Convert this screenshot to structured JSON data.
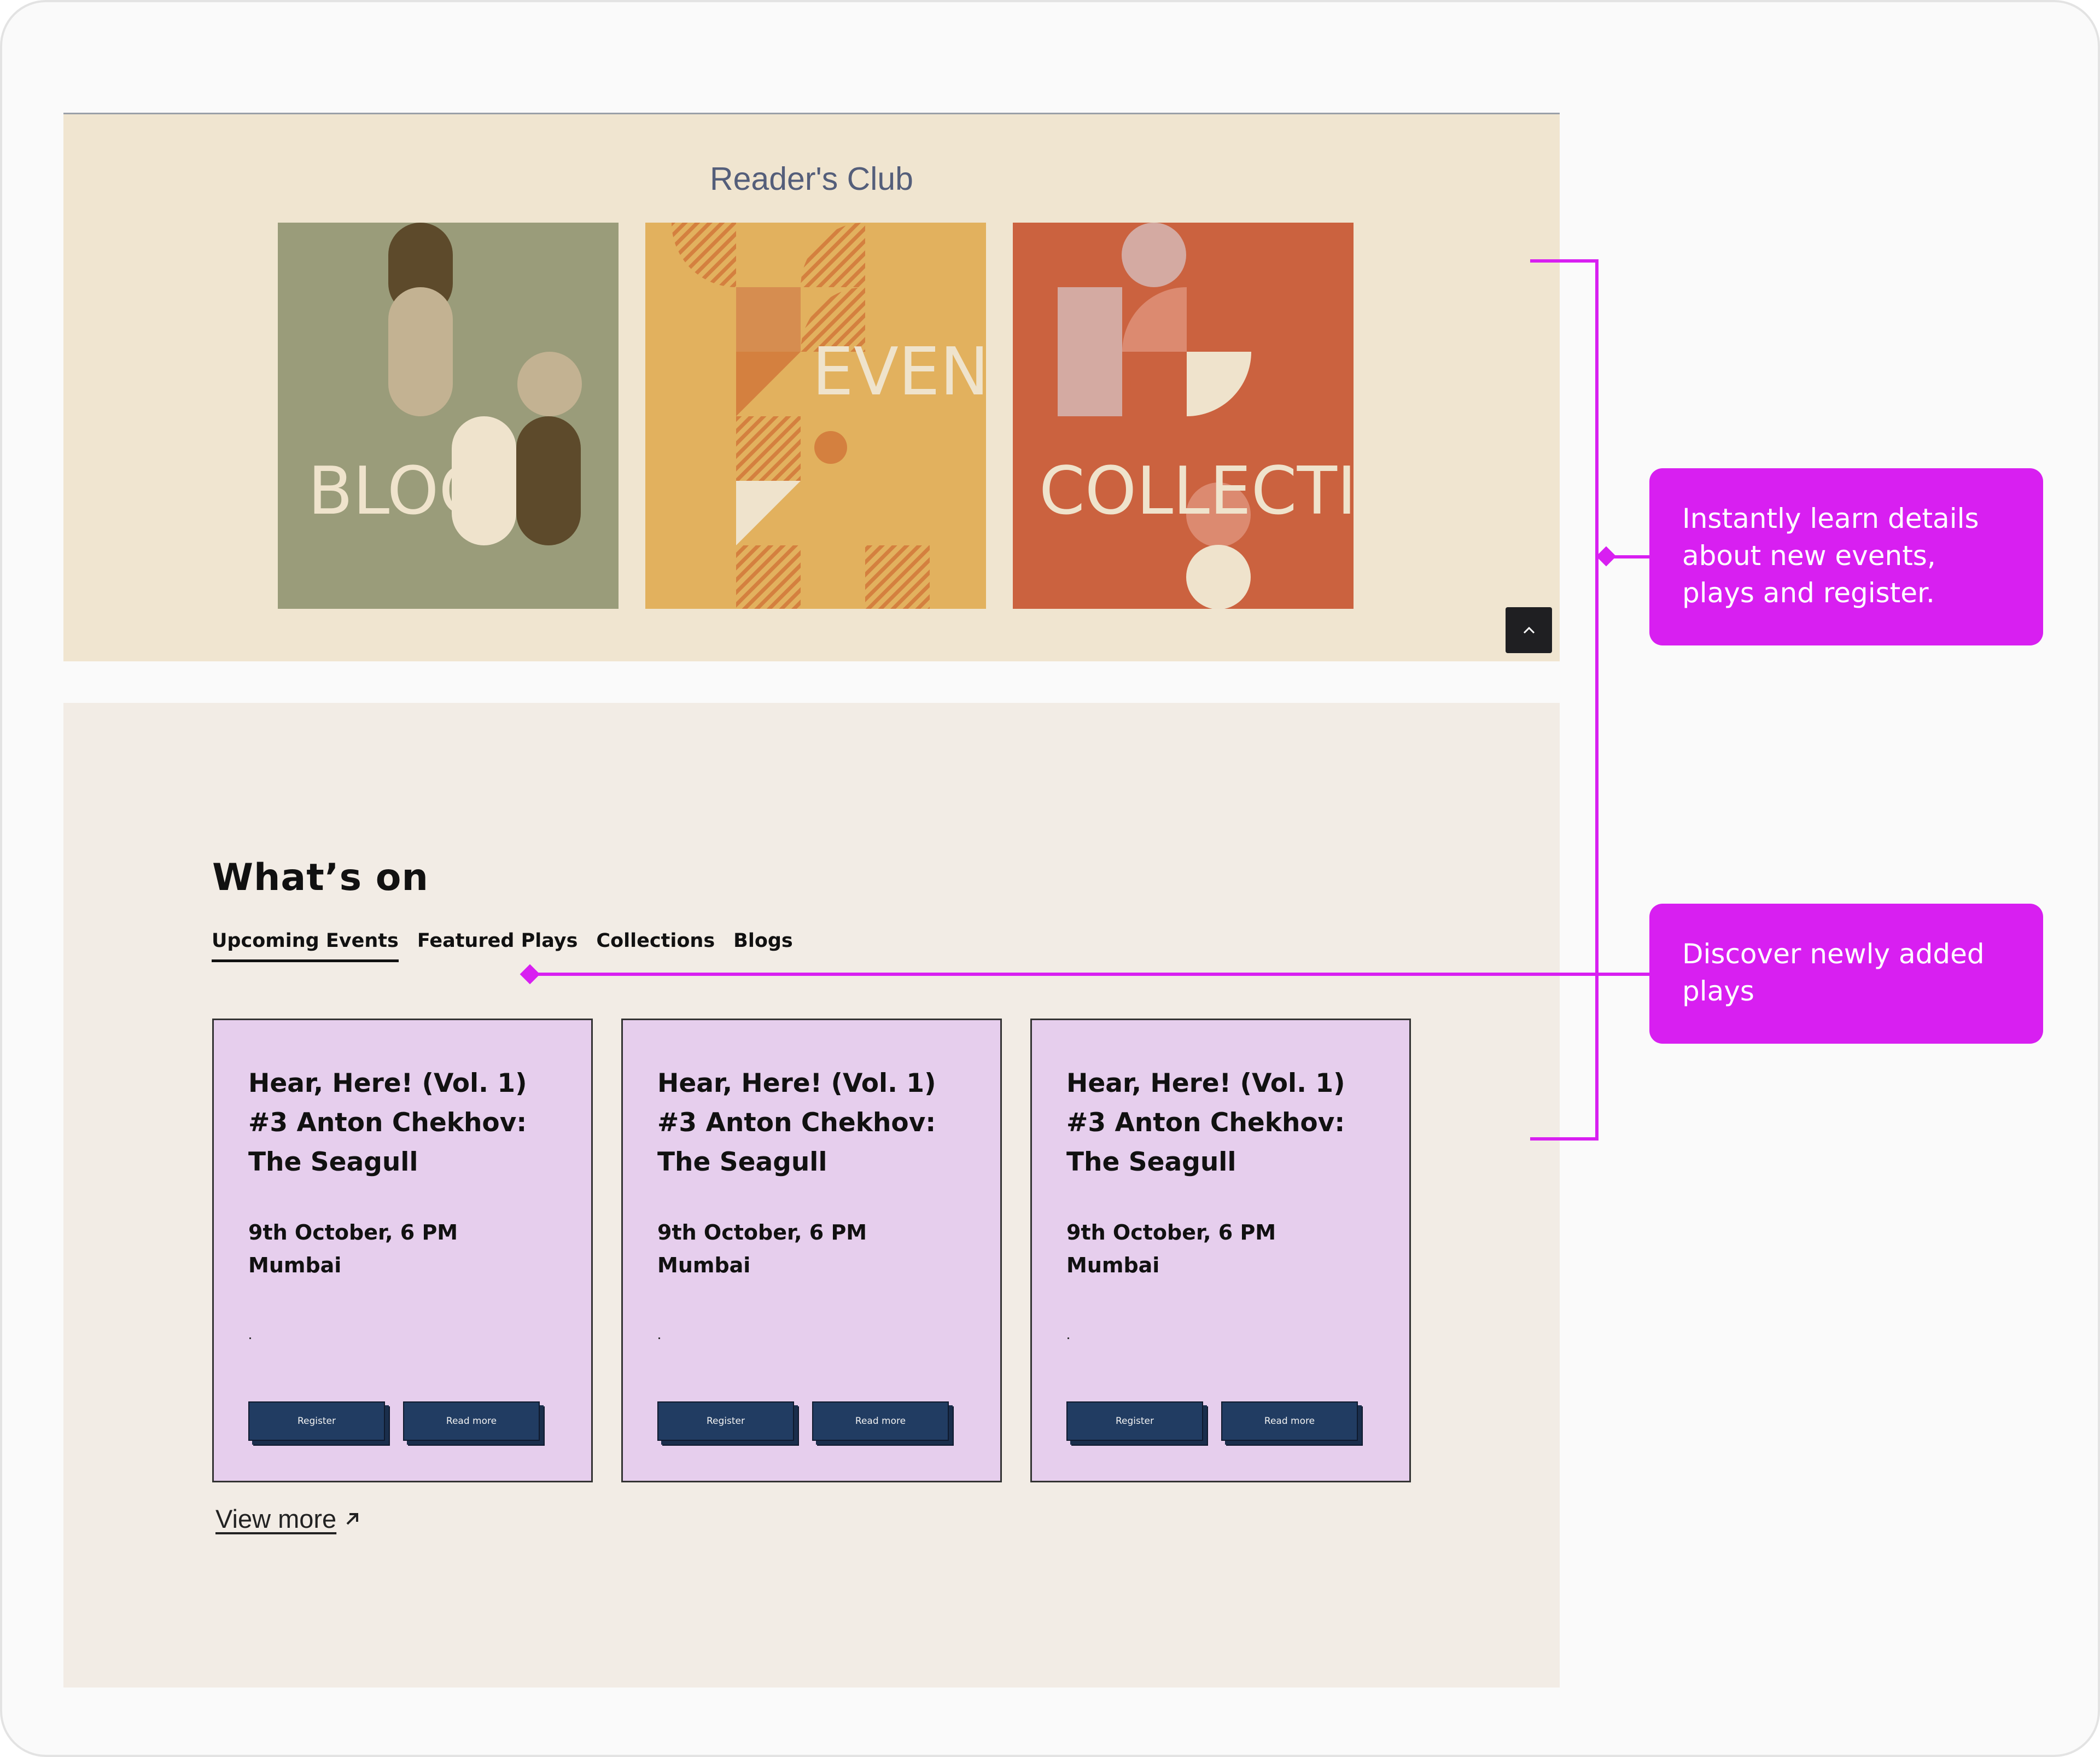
{
  "readers_club": {
    "title": "Reader's Club",
    "tiles": [
      {
        "label": "BLOG",
        "color": "#9a9c7a"
      },
      {
        "label": "EVENTS",
        "color": "#e2b15e"
      },
      {
        "label": "COLLECTIONS",
        "color": "#cb623f"
      }
    ],
    "scroll_top_icon": "chevron-up-icon"
  },
  "whats_on": {
    "title": "What’s on",
    "tabs": [
      {
        "label": "Upcoming Events",
        "active": true
      },
      {
        "label": "Featured Plays",
        "active": false
      },
      {
        "label": "Collections",
        "active": false
      },
      {
        "label": "Blogs",
        "active": false
      }
    ],
    "cards": [
      {
        "title": "Hear, Here! (Vol. 1) #3 Anton Chekhov: The Seagull",
        "date": "9th October, 6 PM",
        "location": "Mumbai",
        "register_label": "Register",
        "read_more_label": "Read more"
      },
      {
        "title": "Hear, Here! (Vol. 1) #3 Anton Chekhov: The Seagull",
        "date": "9th October, 6 PM",
        "location": "Mumbai",
        "register_label": "Register",
        "read_more_label": "Read more"
      },
      {
        "title": "Hear, Here! (Vol. 1) #3 Anton Chekhov: The Seagull",
        "date": "9th October, 6 PM",
        "location": "Mumbai",
        "register_label": "Register",
        "read_more_label": "Read more"
      }
    ],
    "view_more_label": "View more",
    "view_more_icon": "arrow-up-right-icon"
  },
  "annotations": {
    "callout_1": "Instantly learn details about new events, plays and register.",
    "callout_2": "Discover newly added plays",
    "accent_color": "#d81ff1"
  },
  "colors": {
    "card_background": "#e6ceed",
    "button_background": "#213c62",
    "readers_background": "#f0e5d0",
    "whatson_background": "#f2ece5"
  }
}
